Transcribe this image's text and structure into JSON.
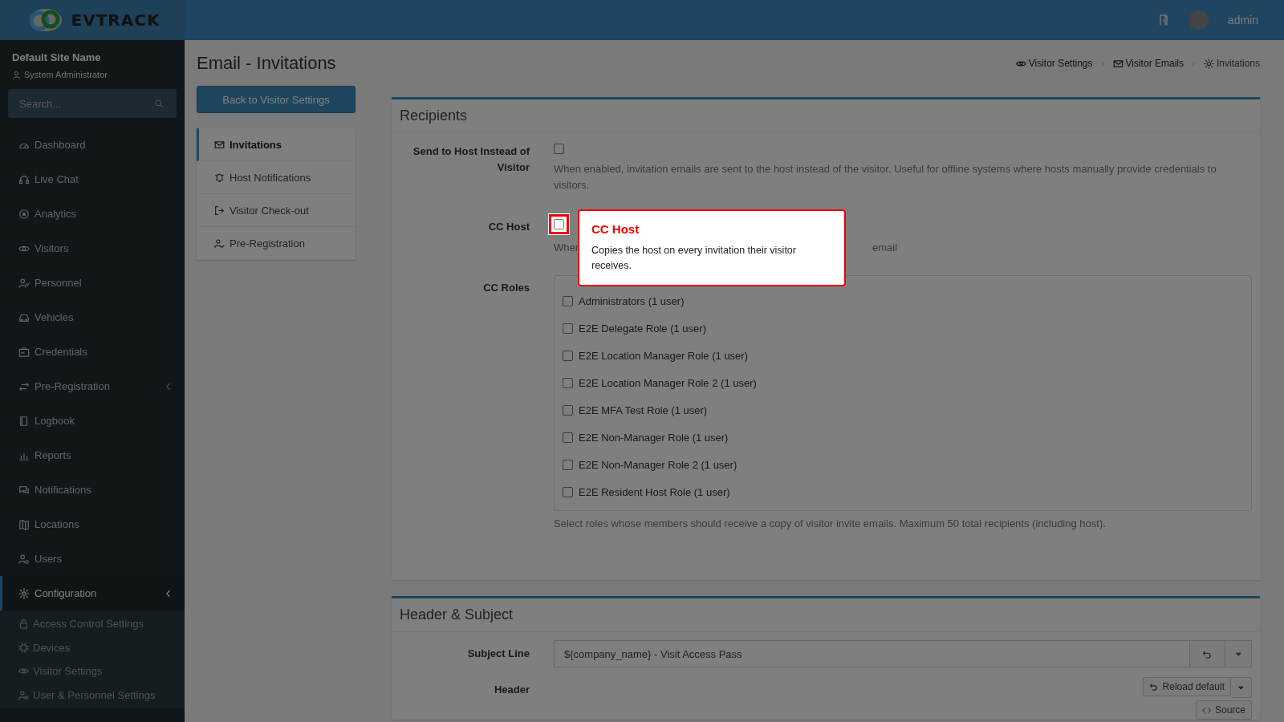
{
  "topbar": {
    "logo": "EVTRACK",
    "user": "admin"
  },
  "sidebar": {
    "site_name": "Default Site Name",
    "role": "System Administrator",
    "search": {
      "placeholder": "Search..."
    },
    "items": [
      {
        "label": "Dashboard",
        "kind": "link",
        "selected": false
      },
      {
        "label": "Live Chat",
        "kind": "link",
        "selected": false
      },
      {
        "label": "Analytics",
        "kind": "link",
        "selected": false
      },
      {
        "label": "Visitors",
        "kind": "link",
        "selected": false
      },
      {
        "label": "Personnel",
        "kind": "link",
        "selected": false
      },
      {
        "label": "Vehicles",
        "kind": "link",
        "selected": false
      },
      {
        "label": "Credentials",
        "kind": "link",
        "selected": false
      },
      {
        "label": "Pre-Registration",
        "kind": "menu",
        "selected": false,
        "expanded": false
      },
      {
        "label": "Logbook",
        "kind": "link",
        "selected": false
      },
      {
        "label": "Reports",
        "kind": "link",
        "selected": false
      },
      {
        "label": "Notifications",
        "kind": "link",
        "selected": false
      },
      {
        "label": "Locations",
        "kind": "link",
        "selected": false
      },
      {
        "label": "Users",
        "kind": "link",
        "selected": false
      },
      {
        "label": "Configuration",
        "kind": "menu",
        "selected": true,
        "expanded": true,
        "children": [
          {
            "label": "Access Control Settings",
            "selected": false
          },
          {
            "label": "Devices",
            "selected": false
          },
          {
            "label": "Visitor Settings",
            "selected": false
          },
          {
            "label": "User & Personnel Settings",
            "selected": false
          }
        ]
      }
    ]
  },
  "page": {
    "title": "Email - Invitations",
    "breadcrumb": [
      "Visitor Settings",
      "Visitor Emails",
      "Invitations"
    ],
    "back_button": "Back to Visitor Settings",
    "subnav": [
      {
        "label": "Invitations",
        "selected": true
      },
      {
        "label": "Host Notifications",
        "selected": false
      },
      {
        "label": "Visitor Check-out",
        "selected": false
      },
      {
        "label": "Pre-Registration",
        "selected": false
      }
    ]
  },
  "recipients": {
    "title": "Recipients",
    "send_to_host": {
      "label": "Send to Host Instead of Visitor",
      "checked": false,
      "spotlight": false,
      "help": "When enabled, invitation emails are sent to the host instead of the visitor. Useful for offline systems where hosts manually provide credentials to visitors."
    },
    "cc_host": {
      "label": "CC Host",
      "checked": false,
      "spotlight": true,
      "help_visible_start": "Wher",
      "help_visible_end": "email"
    },
    "cc_roles": {
      "label": "CC Roles",
      "roles": [
        {
          "label": "Administrators (1 user)",
          "checked": false
        },
        {
          "label": "E2E Delegate Role (1 user)",
          "checked": false
        },
        {
          "label": "E2E Location Manager Role (1 user)",
          "checked": false
        },
        {
          "label": "E2E Location Manager Role 2 (1 user)",
          "checked": false
        },
        {
          "label": "E2E MFA Test Role (1 user)",
          "checked": false
        },
        {
          "label": "E2E Non-Manager Role (1 user)",
          "checked": false
        },
        {
          "label": "E2E Non-Manager Role 2 (1 user)",
          "checked": false
        },
        {
          "label": "E2E Resident Host Role (1 user)",
          "checked": false
        }
      ],
      "help": "Select roles whose members should receive a copy of visitor invite emails. Maximum 50 total recipients (including host)."
    }
  },
  "header_subject": {
    "title": "Header & Subject",
    "subject_label": "Subject Line",
    "subject_value": "${company_name} - Visit Access Pass",
    "header_label": "Header",
    "reload_button": "Reload default",
    "source_button": "Source"
  },
  "tour_tooltip": {
    "title": "CC Host",
    "text": "Copies the host on every invitation their visitor receives."
  }
}
